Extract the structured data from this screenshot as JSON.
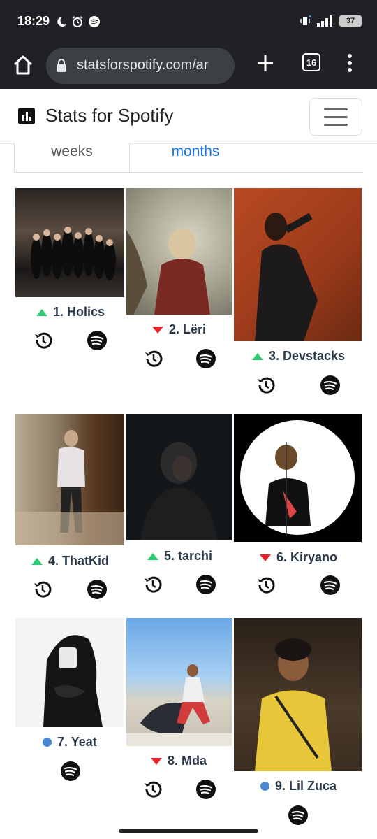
{
  "status_bar": {
    "time": "18:29",
    "battery": "37",
    "icons": [
      "moon-icon",
      "alarm-icon",
      "spotify-status-icon",
      "vibrate-icon",
      "signal-icon",
      "battery-icon"
    ]
  },
  "browser": {
    "url": "statsforspotify.com/ar",
    "tab_count": "16"
  },
  "site": {
    "title": "Stats for Spotify"
  },
  "tabs": {
    "weeks": "weeks",
    "months": "months"
  },
  "colors": {
    "up": "#2ecc71",
    "down": "#e8202a",
    "new": "#4a88d6",
    "name_text": "#2b3a4a",
    "link": "#1a73e8"
  },
  "artists": [
    {
      "rank_label": "1. Holics",
      "trend": "up"
    },
    {
      "rank_label": "2. Lëri",
      "trend": "down"
    },
    {
      "rank_label": "3. Devstacks",
      "trend": "up"
    },
    {
      "rank_label": "4. ThatKid",
      "trend": "up"
    },
    {
      "rank_label": "5. tarchi",
      "trend": "up"
    },
    {
      "rank_label": "6. Kiryano",
      "trend": "down"
    },
    {
      "rank_label": "7. Yeat",
      "trend": "new"
    },
    {
      "rank_label": "8. Mda",
      "trend": "down"
    },
    {
      "rank_label": "9. Lil Zuca",
      "trend": "new"
    }
  ]
}
